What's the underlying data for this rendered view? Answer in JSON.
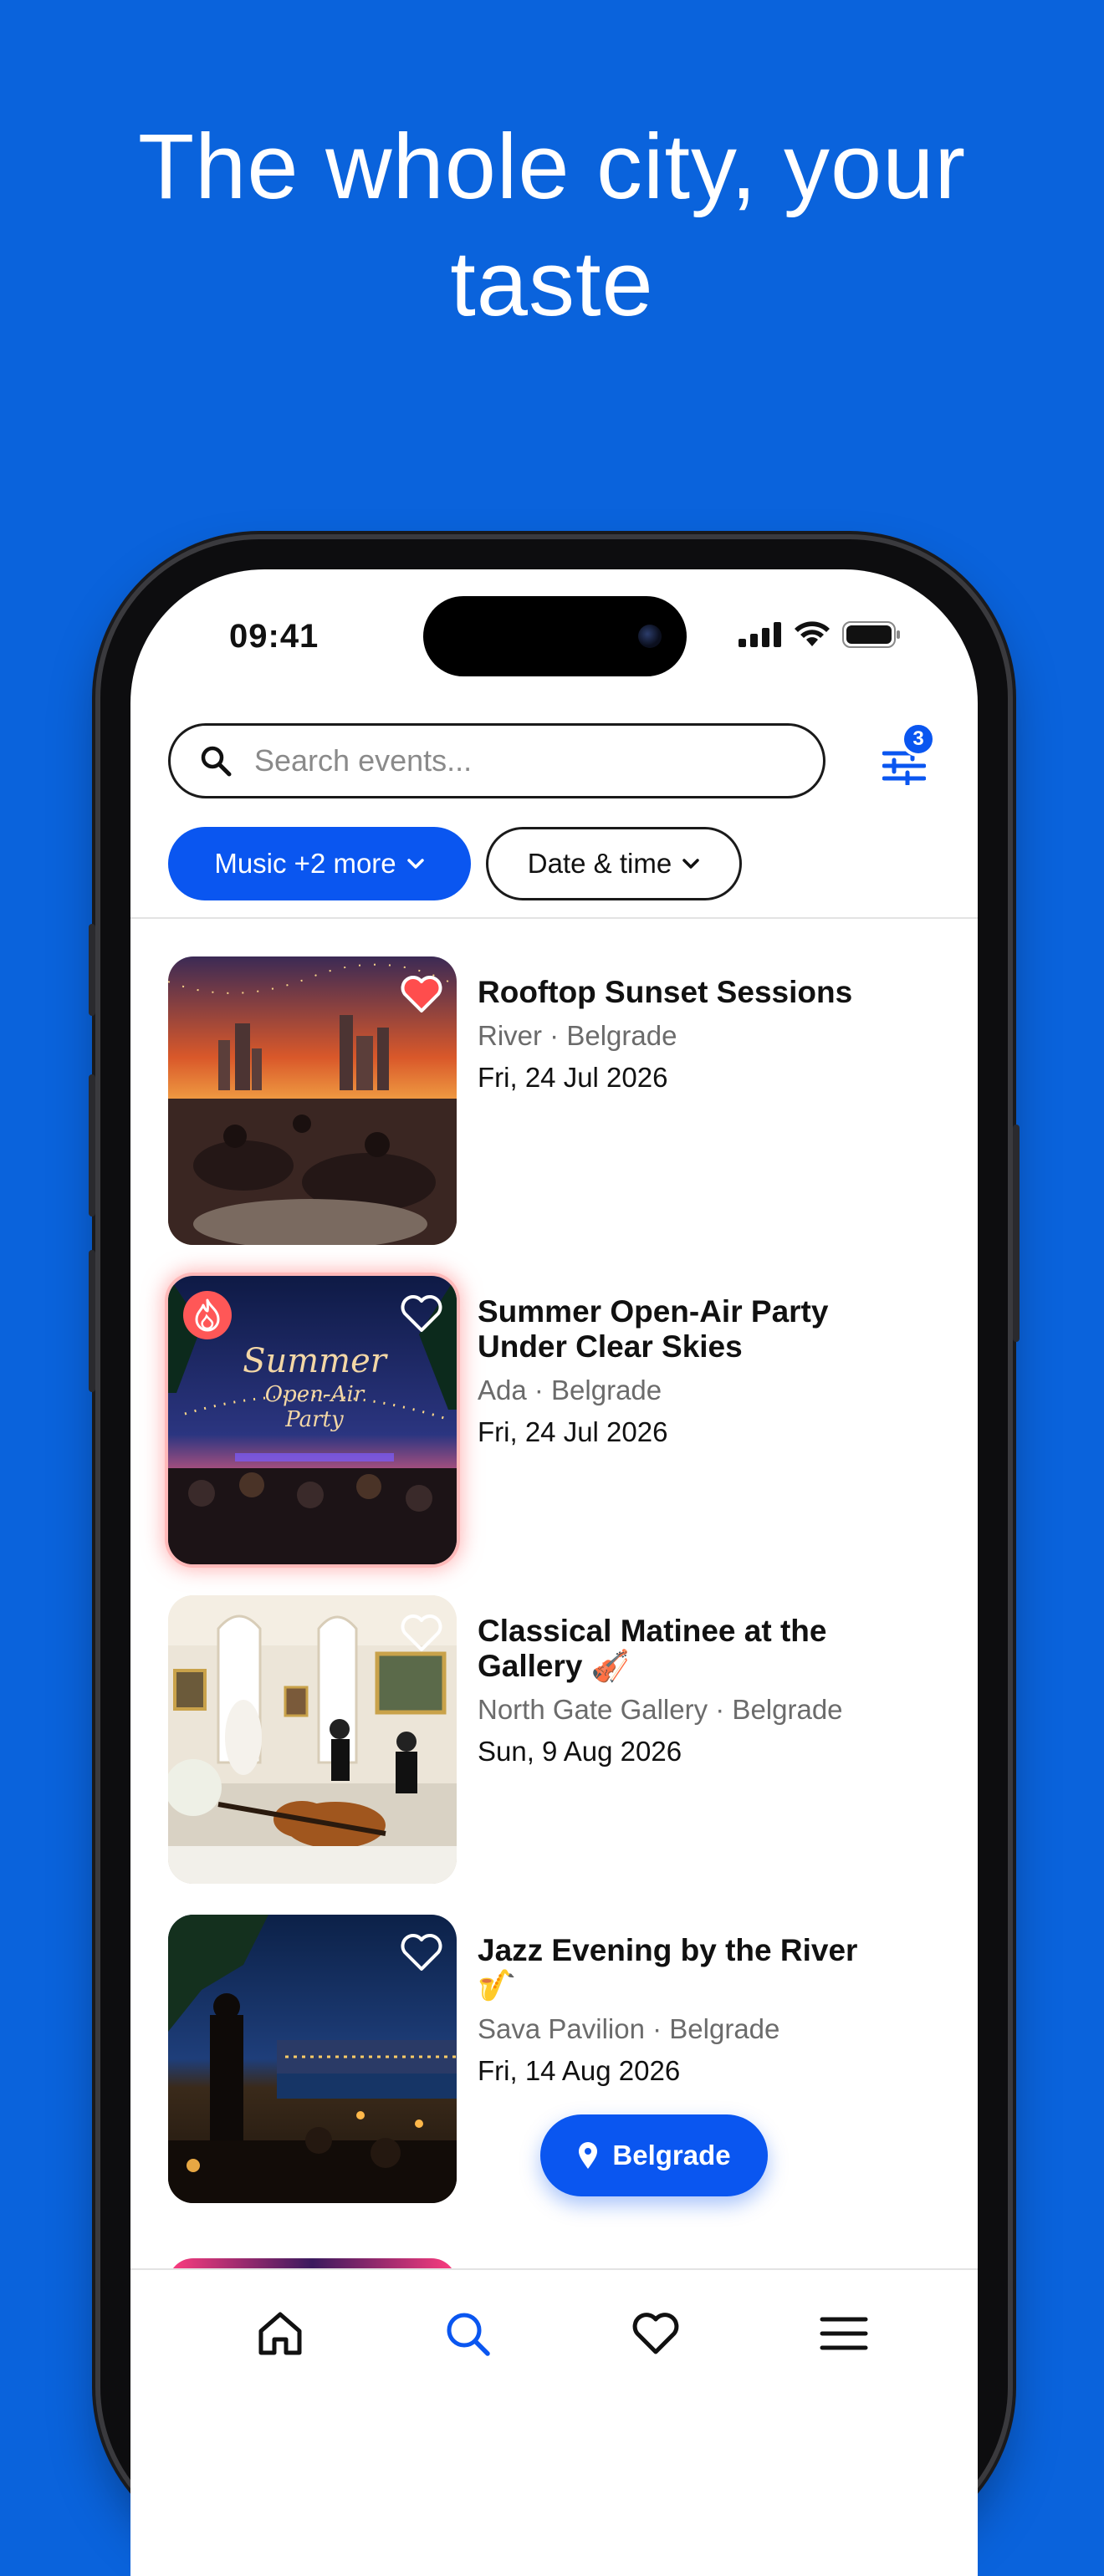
{
  "hero": {
    "title": "The whole city, your taste"
  },
  "status": {
    "time": "09:41"
  },
  "search": {
    "placeholder": "Search events..."
  },
  "filters": {
    "badge_count": "3",
    "chips": [
      {
        "label": "Music +2 more"
      },
      {
        "label": "Date & time"
      }
    ]
  },
  "events": [
    {
      "title": "Rooftop Sunset Sessions",
      "place": "River · Belgrade",
      "date": "Fri, 24 Jul 2026",
      "liked": true,
      "hot": false
    },
    {
      "title": "Summer Open-Air Party Under Clear Skies",
      "place": "Ada · Belgrade",
      "date": "Fri, 24 Jul 2026",
      "liked": false,
      "hot": true,
      "poster_text": [
        "Summer",
        "Open-Air",
        "Party"
      ]
    },
    {
      "title": "Classical Matinee at the Gallery 🎻",
      "place": "North Gate Gallery · Belgrade",
      "date": "Sun, 9 Aug 2026",
      "liked": false,
      "hot": false
    },
    {
      "title": "Jazz Evening by the River 🎷",
      "place": "Sava Pavilion · Belgrade",
      "date": "Fri, 14 Aug 2026",
      "liked": false,
      "hot": false
    }
  ],
  "location": {
    "label": "Belgrade"
  },
  "tabs": [
    {
      "icon": "home-icon",
      "active": false
    },
    {
      "icon": "search-icon",
      "active": true
    },
    {
      "icon": "heart-icon",
      "active": false
    },
    {
      "icon": "menu-icon",
      "active": false
    }
  ],
  "colors": {
    "background": "#0a63dc",
    "accent": "#0a56f0",
    "liked": "#ff4d4d",
    "hot": "#ff5757"
  }
}
